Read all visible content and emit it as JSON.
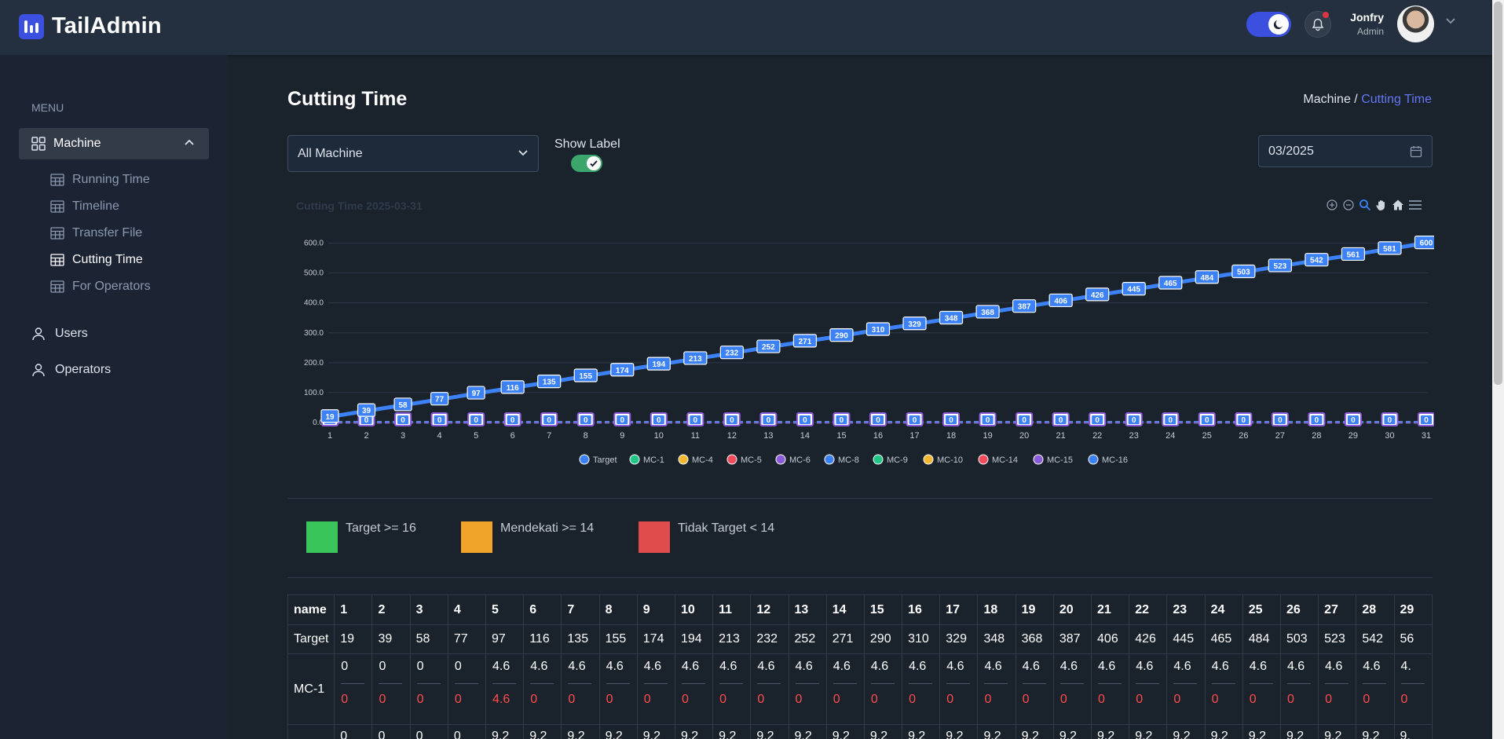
{
  "app": {
    "name": "TailAdmin"
  },
  "header": {
    "user_name": "Jonfry",
    "user_role": "Admin"
  },
  "sidebar": {
    "menu_label": "MENU",
    "group": {
      "label": "Machine",
      "expanded": true
    },
    "sub_items": [
      {
        "label": "Running Time",
        "active": false
      },
      {
        "label": "Timeline",
        "active": false
      },
      {
        "label": "Transfer File",
        "active": false
      },
      {
        "label": "Cutting Time",
        "active": true
      },
      {
        "label": "For Operators",
        "active": false
      }
    ],
    "items": [
      {
        "label": "Users"
      },
      {
        "label": "Operators"
      }
    ]
  },
  "page": {
    "title": "Cutting Time",
    "breadcrumb": {
      "parent": "Machine /",
      "current": "Cutting Time"
    },
    "machine_select": "All Machine",
    "show_label": {
      "label": "Show Label",
      "checked": true
    },
    "date": "03/2025"
  },
  "legend_boxes": [
    {
      "label": "Target >= 16",
      "color": "#3ac55b"
    },
    {
      "label": "Mendekati >= 14",
      "color": "#f0a52a"
    },
    {
      "label": "Tidak Target < 14",
      "color": "#e04b4b"
    }
  ],
  "colors": {
    "accent": "#3c50e0",
    "target": "#3c82f6",
    "sidebar": "#1c2434",
    "bg": "#1a222c"
  },
  "chart_data": {
    "type": "line",
    "title": "Cutting Time 2025-03-31",
    "x": [
      1,
      2,
      3,
      4,
      5,
      6,
      7,
      8,
      9,
      10,
      11,
      12,
      13,
      14,
      15,
      16,
      17,
      18,
      19,
      20,
      21,
      22,
      23,
      24,
      25,
      26,
      27,
      28,
      29,
      30,
      31
    ],
    "y_ticks": [
      "0.0",
      "100.0",
      "200.0",
      "300.0",
      "400.0",
      "500.0",
      "600.0"
    ],
    "ylim": [
      0,
      620
    ],
    "legend_position": "bottom",
    "series": [
      {
        "name": "Target",
        "color": "#3c82f6",
        "values": [
          19,
          39,
          58,
          77,
          97,
          116,
          135,
          155,
          174,
          194,
          213,
          232,
          252,
          271,
          290,
          310,
          329,
          348,
          368,
          387,
          406,
          426,
          445,
          465,
          484,
          503,
          523,
          542,
          561,
          581,
          600
        ]
      },
      {
        "name": "MC-1",
        "color": "#22c585",
        "values": [
          0,
          0,
          0,
          0,
          0,
          0,
          0,
          0,
          0,
          0,
          0,
          0,
          0,
          0,
          0,
          0,
          0,
          0,
          0,
          0,
          0,
          0,
          0,
          0,
          0,
          0,
          0,
          0,
          0,
          0,
          0
        ]
      },
      {
        "name": "MC-4",
        "color": "#f5b731",
        "values": [
          0,
          0,
          0,
          0,
          0,
          0,
          0,
          0,
          0,
          0,
          0,
          0,
          0,
          0,
          0,
          0,
          0,
          0,
          0,
          0,
          0,
          0,
          0,
          0,
          0,
          0,
          0,
          0,
          0,
          0,
          0
        ]
      },
      {
        "name": "MC-5",
        "color": "#f04c5c",
        "values": [
          0,
          0,
          0,
          0,
          0,
          0,
          0,
          0,
          0,
          0,
          0,
          0,
          0,
          0,
          0,
          0,
          0,
          0,
          0,
          0,
          0,
          0,
          0,
          0,
          0,
          0,
          0,
          0,
          0,
          0,
          0
        ]
      },
      {
        "name": "MC-6",
        "color": "#8a5cdc",
        "values": [
          0,
          0,
          0,
          0,
          0,
          0,
          0,
          0,
          0,
          0,
          0,
          0,
          0,
          0,
          0,
          0,
          0,
          0,
          0,
          0,
          0,
          0,
          0,
          0,
          0,
          0,
          0,
          0,
          0,
          0,
          0
        ]
      },
      {
        "name": "MC-8",
        "color": "#3c82f6",
        "values": [
          0,
          0,
          0,
          0,
          0,
          0,
          0,
          0,
          0,
          0,
          0,
          0,
          0,
          0,
          0,
          0,
          0,
          0,
          0,
          0,
          0,
          0,
          0,
          0,
          0,
          0,
          0,
          0,
          0,
          0,
          0
        ]
      },
      {
        "name": "MC-9",
        "color": "#22c585",
        "values": [
          0,
          0,
          0,
          0,
          0,
          0,
          0,
          0,
          0,
          0,
          0,
          0,
          0,
          0,
          0,
          0,
          0,
          0,
          0,
          0,
          0,
          0,
          0,
          0,
          0,
          0,
          0,
          0,
          0,
          0,
          0
        ]
      },
      {
        "name": "MC-10",
        "color": "#f5b731",
        "values": [
          0,
          0,
          0,
          0,
          0,
          0,
          0,
          0,
          0,
          0,
          0,
          0,
          0,
          0,
          0,
          0,
          0,
          0,
          0,
          0,
          0,
          0,
          0,
          0,
          0,
          0,
          0,
          0,
          0,
          0,
          0
        ]
      },
      {
        "name": "MC-14",
        "color": "#f04c5c",
        "values": [
          0,
          0,
          0,
          0,
          0,
          0,
          0,
          0,
          0,
          0,
          0,
          0,
          0,
          0,
          0,
          0,
          0,
          0,
          0,
          0,
          0,
          0,
          0,
          0,
          0,
          0,
          0,
          0,
          0,
          0,
          0
        ]
      },
      {
        "name": "MC-15",
        "color": "#8a5cdc",
        "values": [
          0,
          0,
          0,
          0,
          0,
          0,
          0,
          0,
          0,
          0,
          0,
          0,
          0,
          0,
          0,
          0,
          0,
          0,
          0,
          0,
          0,
          0,
          0,
          0,
          0,
          0,
          0,
          0,
          0,
          0,
          0
        ]
      },
      {
        "name": "MC-16",
        "color": "#3c82f6",
        "values": [
          0,
          0,
          0,
          0,
          0,
          0,
          0,
          0,
          0,
          0,
          0,
          0,
          0,
          0,
          0,
          0,
          0,
          0,
          0,
          0,
          0,
          0,
          0,
          0,
          0,
          0,
          0,
          0,
          0,
          0,
          0
        ]
      }
    ]
  },
  "table": {
    "header": [
      "name",
      "1",
      "2",
      "3",
      "4",
      "5",
      "6",
      "7",
      "8",
      "9",
      "10",
      "11",
      "12",
      "13",
      "14",
      "15",
      "16",
      "17",
      "18",
      "19",
      "20",
      "21",
      "22",
      "23",
      "24",
      "25",
      "26",
      "27",
      "28",
      "29"
    ],
    "target_row": {
      "name": "Target",
      "values": [
        "19",
        "39",
        "58",
        "77",
        "97",
        "116",
        "135",
        "155",
        "174",
        "194",
        "213",
        "232",
        "252",
        "271",
        "290",
        "310",
        "329",
        "348",
        "368",
        "387",
        "406",
        "426",
        "445",
        "465",
        "484",
        "503",
        "523",
        "542",
        "56"
      ]
    },
    "mc1_row": {
      "name": "MC-1",
      "top": [
        "0",
        "0",
        "0",
        "0",
        "4.6",
        "4.6",
        "4.6",
        "4.6",
        "4.6",
        "4.6",
        "4.6",
        "4.6",
        "4.6",
        "4.6",
        "4.6",
        "4.6",
        "4.6",
        "4.6",
        "4.6",
        "4.6",
        "4.6",
        "4.6",
        "4.6",
        "4.6",
        "4.6",
        "4.6",
        "4.6",
        "4.6",
        "4."
      ],
      "bottom": [
        "0",
        "0",
        "0",
        "0",
        "4.6",
        "0",
        "0",
        "0",
        "0",
        "0",
        "0",
        "0",
        "0",
        "0",
        "0",
        "0",
        "0",
        "0",
        "0",
        "0",
        "0",
        "0",
        "0",
        "0",
        "0",
        "0",
        "0",
        "0",
        "0"
      ]
    },
    "next_row_partial": [
      "0",
      "0",
      "0",
      "0",
      "9.2",
      "9.2",
      "9.2",
      "9.2",
      "9.2",
      "9.2",
      "9.2",
      "9.2",
      "9.2",
      "9.2",
      "9.2",
      "9.2",
      "9.2",
      "9.2",
      "9.2",
      "9.2",
      "9.2",
      "9.2",
      "9.2",
      "9.2",
      "9.2",
      "9.2",
      "9.2",
      "9.2",
      "9."
    ]
  }
}
